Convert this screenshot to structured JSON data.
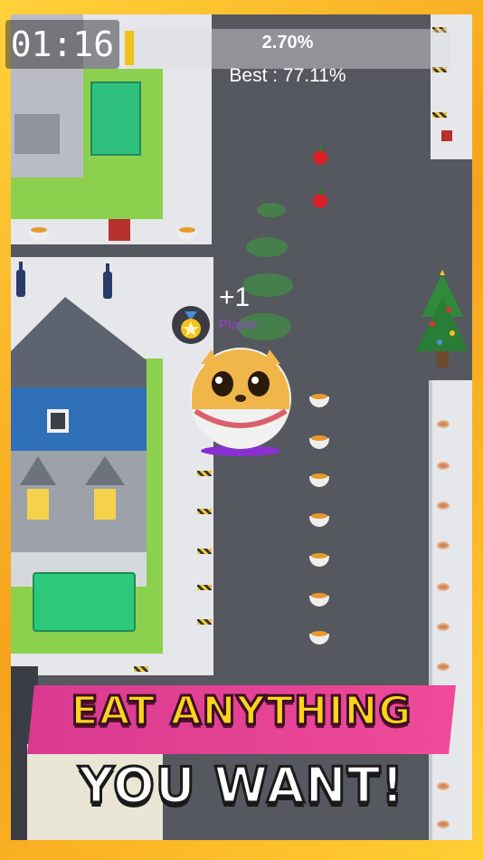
{
  "hud": {
    "timer": "01:16",
    "progress_percent_label": "2.70%",
    "progress_value": 0.027,
    "best_label": "Best : 77.11%"
  },
  "player": {
    "score_popup": "+1",
    "name": "Player"
  },
  "banner": {
    "line1": "EAT ANYTHING",
    "line2": "YOU WANT!"
  },
  "colors": {
    "frame": "#f7a21c",
    "road": "#56595f",
    "grass": "#8bd14d",
    "banner_bg": "#e2408f",
    "banner_text": "#ffd41c",
    "progress_fill": "#f0c21a",
    "player_name": "#9b3bd3"
  }
}
